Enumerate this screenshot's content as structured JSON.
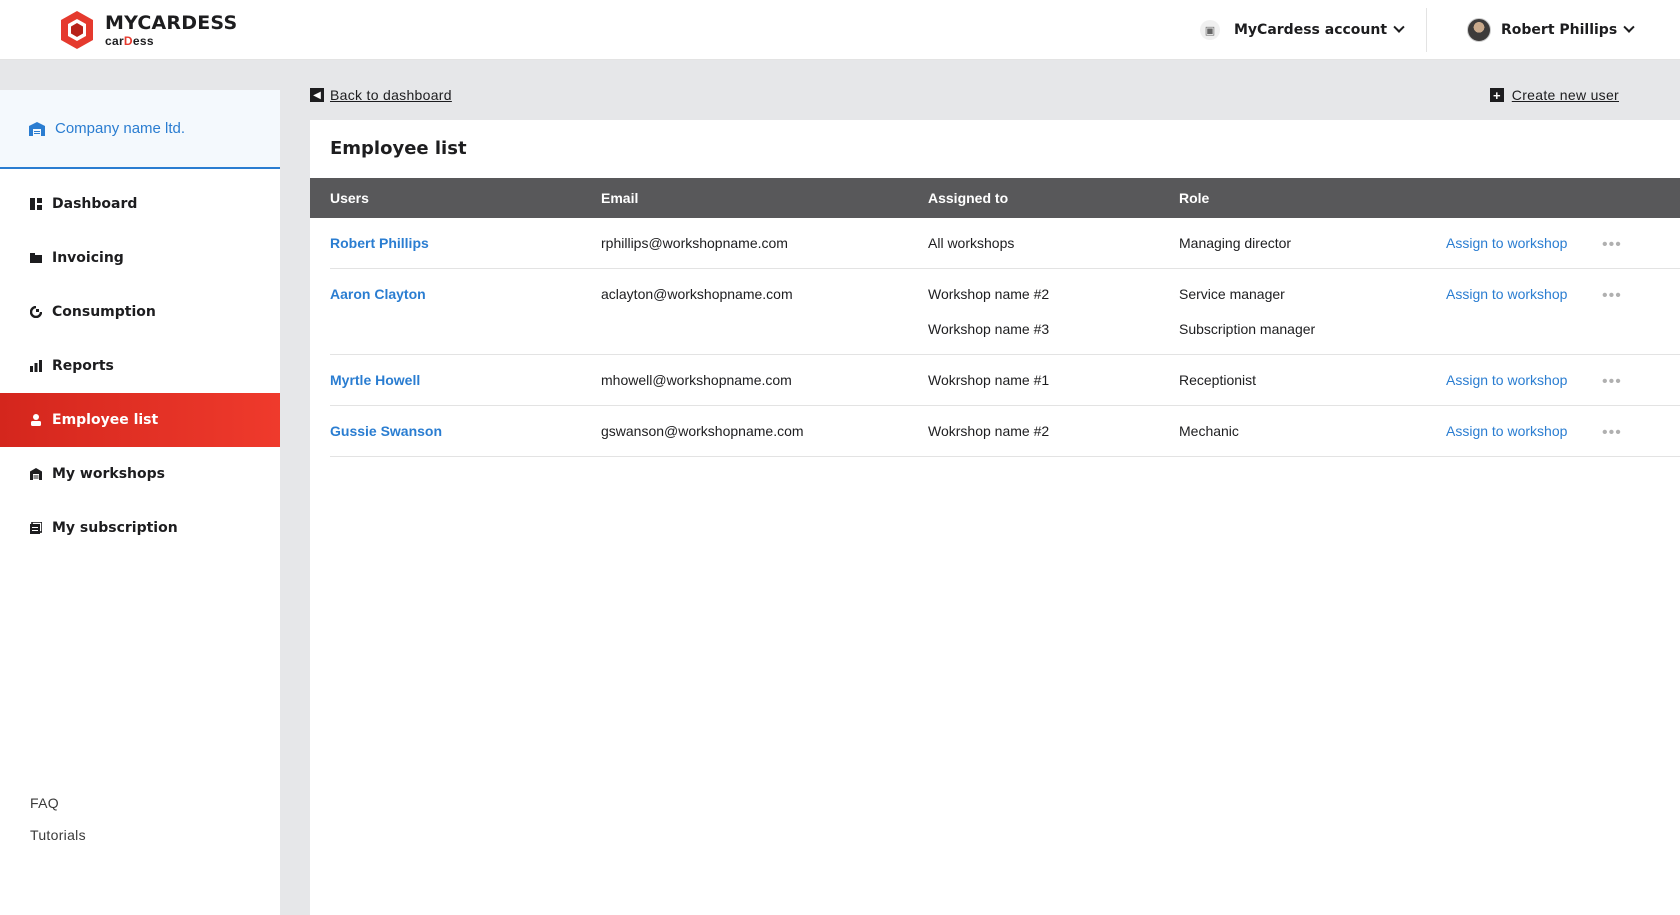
{
  "brand": {
    "name": "MYCARDESS",
    "sub_prefix": "car",
    "sub_red": "D",
    "sub_suffix": "ess"
  },
  "header": {
    "account_label": "MyCardess account",
    "user_name": "Robert Phillips"
  },
  "sidebar": {
    "company": "Company name ltd.",
    "items": [
      {
        "label": "Dashboard",
        "icon": "dashboard-icon"
      },
      {
        "label": "Invoicing",
        "icon": "folder-icon"
      },
      {
        "label": "Consumption",
        "icon": "consumption-icon"
      },
      {
        "label": "Reports",
        "icon": "bar-chart-icon"
      },
      {
        "label": "Employee list",
        "icon": "person-icon",
        "active": true
      },
      {
        "label": "My workshops",
        "icon": "garage-icon"
      },
      {
        "label": "My subscription",
        "icon": "subscription-icon"
      }
    ],
    "footer_links": [
      "FAQ",
      "Tutorials"
    ]
  },
  "toolbar": {
    "back_label": "Back to dashboard",
    "create_label": "Create new user"
  },
  "main": {
    "title": "Employee list",
    "columns": [
      "Users",
      "Email",
      "Assigned to",
      "Role"
    ],
    "rows": [
      {
        "name": "Robert Phillips",
        "email": "rphillips@workshopname.com",
        "assigned": [
          "All workshops"
        ],
        "roles": [
          "Managing director"
        ],
        "action": "Assign to workshop",
        "more": "•••"
      },
      {
        "name": "Aaron Clayton",
        "email": "aclayton@workshopname.com",
        "assigned": [
          "Workshop name #2",
          "Workshop name #3"
        ],
        "roles": [
          "Service manager",
          "Subscription manager"
        ],
        "action": "Assign to workshop",
        "more": "•••"
      },
      {
        "name": "Myrtle Howell",
        "email": "mhowell@workshopname.com",
        "assigned": [
          "Wokrshop name #1"
        ],
        "roles": [
          "Receptionist"
        ],
        "action": "Assign to workshop",
        "more": "•••"
      },
      {
        "name": "Gussie Swanson",
        "email": "gswanson@workshopname.com",
        "assigned": [
          "Wokrshop name #2"
        ],
        "roles": [
          "Mechanic"
        ],
        "action": "Assign to workshop",
        "more": "•••"
      }
    ]
  },
  "colors": {
    "accent_blue": "#2a7dd1",
    "active_red": "#e53a2e",
    "table_header": "#58585a"
  }
}
